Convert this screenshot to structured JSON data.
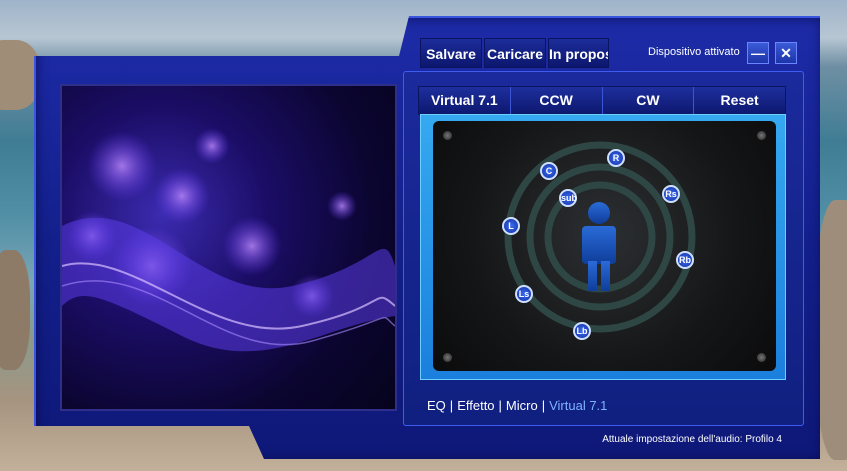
{
  "toolbar": {
    "save_label": "Salvare",
    "load_label": "Caricare",
    "about_label": "In proposito",
    "device_status": "Dispositivo attivato",
    "minimize_icon": "minimize-icon",
    "close_icon": "close-icon"
  },
  "tabs": [
    {
      "label": "Virtual 7.1"
    },
    {
      "label": "CCW"
    },
    {
      "label": "CW"
    },
    {
      "label": "Reset"
    }
  ],
  "speakers": [
    {
      "label": "R"
    },
    {
      "label": "C"
    },
    {
      "label": "sub"
    },
    {
      "label": "Rs"
    },
    {
      "label": "L"
    },
    {
      "label": "Rb"
    },
    {
      "label": "Ls"
    },
    {
      "label": "Lb"
    }
  ],
  "bottom_nav": [
    {
      "label": "EQ"
    },
    {
      "label": "Effetto"
    },
    {
      "label": "Micro"
    },
    {
      "label": "Virtual 7.1"
    }
  ],
  "status": "Attuale impostazione dell'audio: Profilo 4",
  "colors": {
    "accent": "#1b2a9c",
    "active_nav": "#7fb3ff"
  }
}
